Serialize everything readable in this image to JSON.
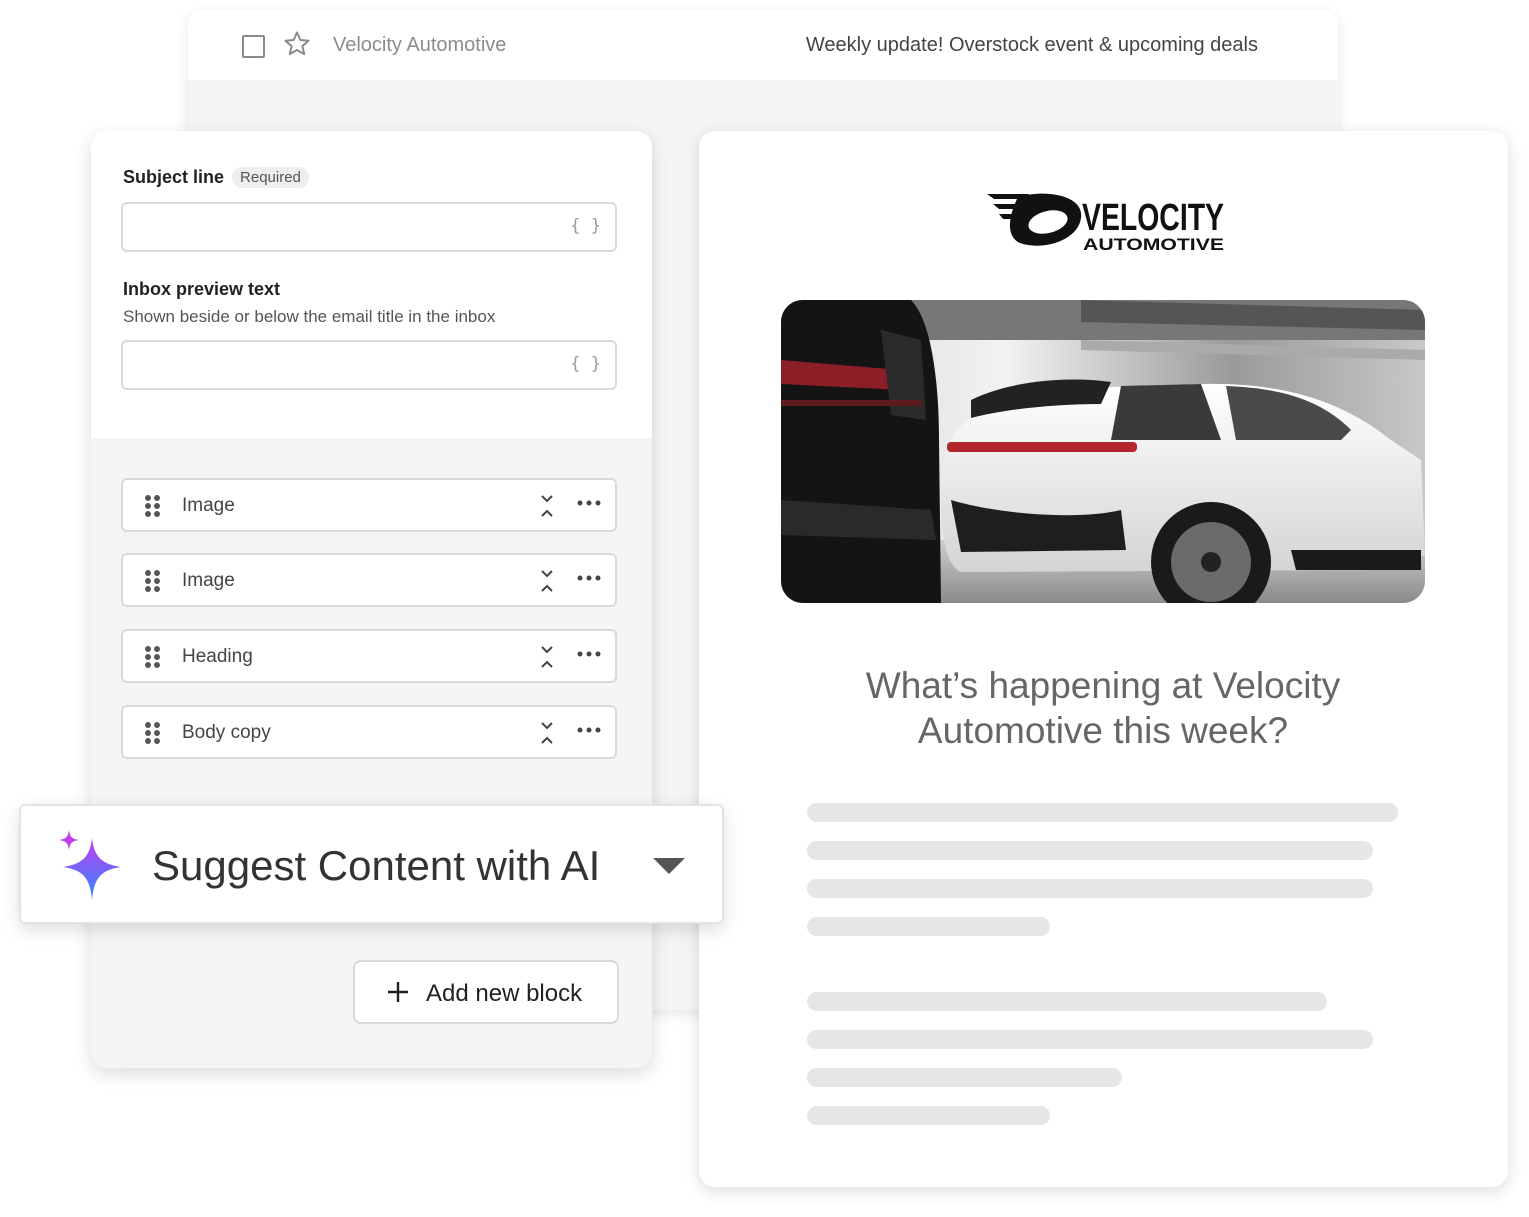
{
  "inbox": {
    "sender": "Velocity Automotive",
    "subject": "Weekly update! Overstock event & upcoming deals"
  },
  "editor": {
    "subject_label": "Subject line",
    "required_badge": "Required",
    "subject_value": "",
    "preview_label": "Inbox preview text",
    "preview_help": "Shown beside or below the email title in the inbox",
    "preview_value": "",
    "blocks": [
      {
        "label": "Image"
      },
      {
        "label": "Image"
      },
      {
        "label": "Heading"
      },
      {
        "label": "Body copy"
      }
    ],
    "add_block_label": "Add new block"
  },
  "ai": {
    "label": "Suggest Content with AI"
  },
  "email_preview": {
    "logo_line1": "VELOCITY",
    "logo_line2": "AUTOMOTIVE",
    "headline": "What’s happening at Velocity Automotive this week?"
  },
  "colors": {
    "ai_gradient_start": "#c13df0",
    "ai_gradient_end": "#2f8bff",
    "skeleton": "#e6e6e6"
  }
}
